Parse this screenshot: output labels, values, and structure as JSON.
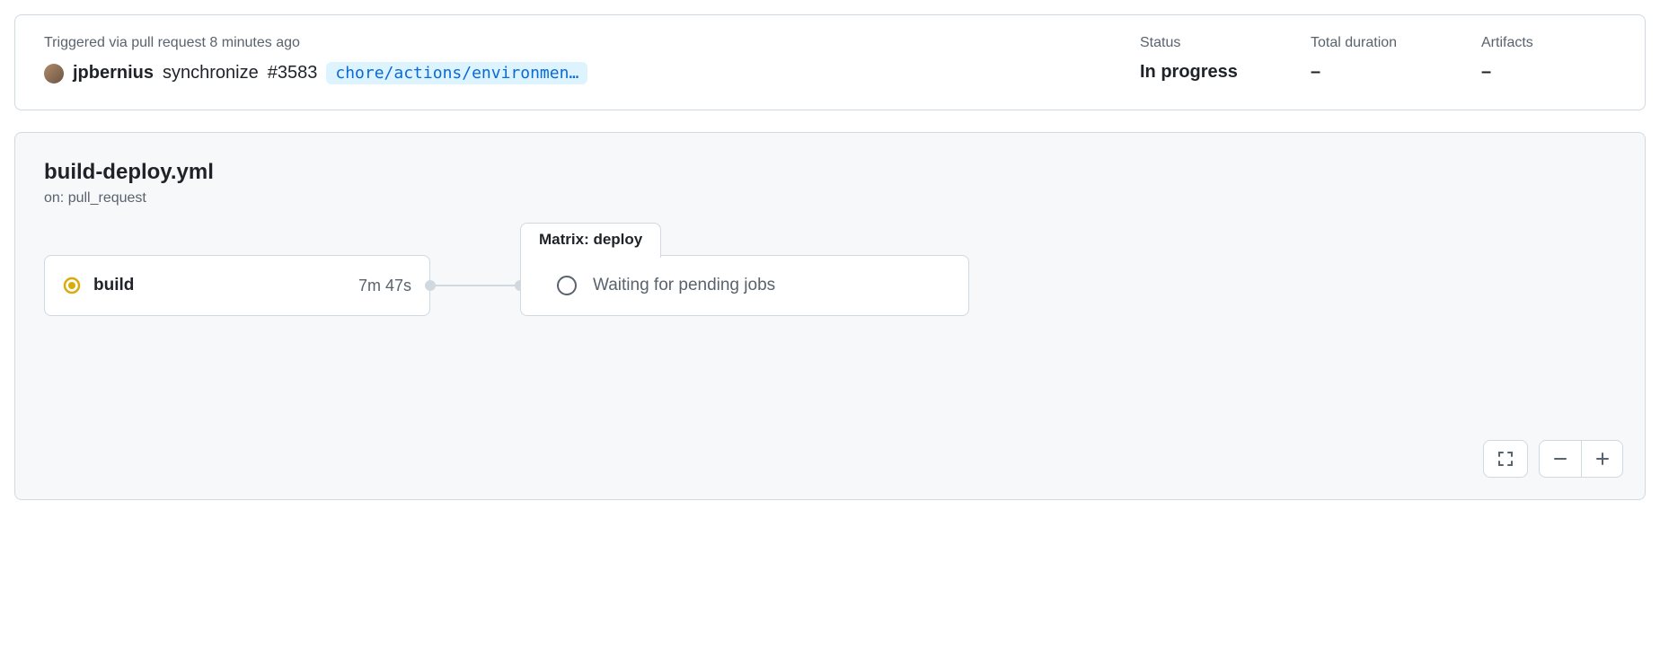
{
  "summary": {
    "trigger_text": "Triggered via pull request 8 minutes ago",
    "actor": "jpbernius",
    "action": "synchronize",
    "pr_number": "#3583",
    "branch": "chore/actions/environmen…",
    "status_label": "Status",
    "status_value": "In progress",
    "duration_label": "Total duration",
    "duration_value": "–",
    "artifacts_label": "Artifacts",
    "artifacts_value": "–"
  },
  "workflow": {
    "file": "build-deploy.yml",
    "on_label": "on: pull_request",
    "job": {
      "name": "build",
      "duration": "7m 47s",
      "status": "in_progress"
    },
    "matrix": {
      "label": "Matrix: deploy",
      "message": "Waiting for pending jobs"
    }
  }
}
